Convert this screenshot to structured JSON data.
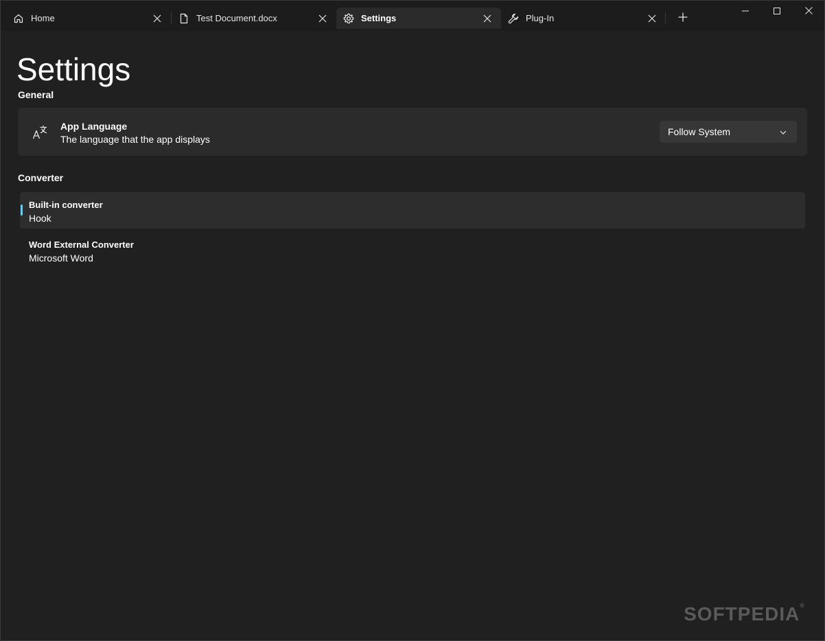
{
  "tabs": [
    {
      "label": "Home",
      "icon": "home-icon"
    },
    {
      "label": "Test Document.docx",
      "icon": "document-icon"
    },
    {
      "label": "Settings",
      "icon": "gear-icon"
    },
    {
      "label": "Plug-In",
      "icon": "wrench-icon"
    }
  ],
  "page": {
    "title": "Settings"
  },
  "general": {
    "header": "General",
    "app_language": {
      "title": "App Language",
      "description": "The language that the app displays",
      "selected": "Follow System",
      "icon": "language-icon"
    }
  },
  "converter": {
    "header": "Converter",
    "items": [
      {
        "title": "Built-in converter",
        "value": "Hook"
      },
      {
        "title": "Word External Converter",
        "value": "Microsoft Word"
      }
    ]
  },
  "watermark": {
    "text": "SOFTPEDIA",
    "mark": "®"
  },
  "colors": {
    "accent": "#60cdff",
    "background": "#202020",
    "card": "#2b2b2b"
  }
}
